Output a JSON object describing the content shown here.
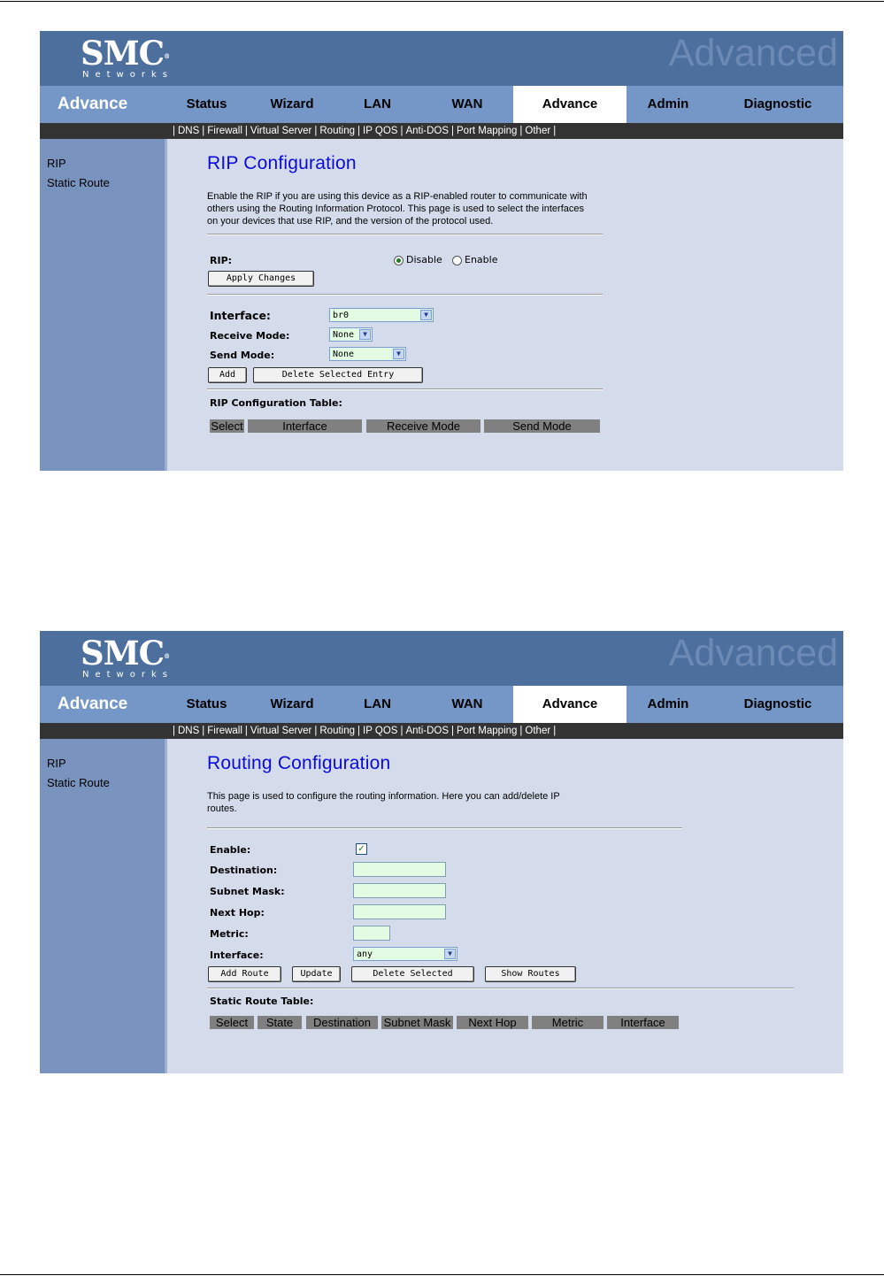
{
  "common": {
    "logo": "SMC",
    "logo_sub": "Networks",
    "logo_reg": "®",
    "watermark": "Advanced",
    "section": "Advance",
    "nav": [
      "Status",
      "Wizard",
      "LAN",
      "WAN",
      "Advance",
      "Admin",
      "Diagnostic"
    ],
    "subnav": [
      "DNS",
      "Firewall",
      "Virtual Server",
      "Routing",
      "IP QOS",
      "Anti-DOS",
      "Port Mapping",
      "Other"
    ],
    "sidebar": [
      "RIP",
      "Static Route"
    ],
    "active_nav": "Advance"
  },
  "rip": {
    "title": "RIP Configuration",
    "description": "Enable the RIP if you are using this device as a RIP-enabled router to communicate with others using the Routing Information Protocol. This page is used to select the interfaces on your devices that use RIP, and the version of the protocol used.",
    "rip_label": "RIP:",
    "disable_label": "Disable",
    "enable_label": "Enable",
    "rip_selected": "Disable",
    "apply_button": "Apply Changes",
    "interface_label": "Interface:",
    "interface_value": "br0",
    "receive_mode_label": "Receive Mode:",
    "receive_mode_value": "None",
    "send_mode_label": "Send Mode:",
    "send_mode_value": "None",
    "add_button": "Add",
    "delete_button": "Delete Selected Entry",
    "table_title": "RIP Configuration Table:",
    "table_headers": [
      "Select",
      "Interface",
      "Receive Mode",
      "Send Mode"
    ]
  },
  "routing": {
    "title": "Routing Configuration",
    "description": "This page is used to configure the routing information. Here you can add/delete IP routes.",
    "enable_label": "Enable:",
    "enable_checked": true,
    "destination_label": "Destination:",
    "destination_value": "",
    "subnet_mask_label": "Subnet Mask:",
    "subnet_mask_value": "",
    "next_hop_label": "Next Hop:",
    "next_hop_value": "",
    "metric_label": "Metric:",
    "metric_value": "",
    "interface_label": "Interface:",
    "interface_value": "any",
    "add_route_button": "Add Route",
    "update_button": "Update",
    "delete_selected_button": "Delete Selected",
    "show_routes_button": "Show Routes",
    "table_title": "Static Route Table:",
    "table_headers": [
      "Select",
      "State",
      "Destination",
      "Subnet Mask",
      "Next Hop",
      "Metric",
      "Interface"
    ]
  }
}
